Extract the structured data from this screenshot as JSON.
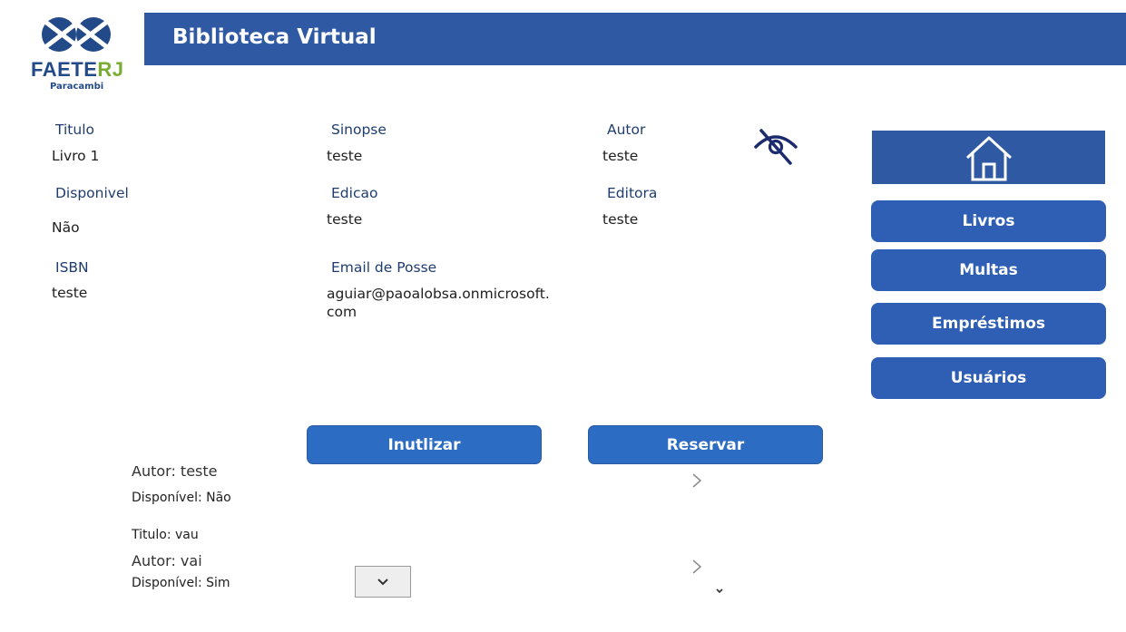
{
  "logo": {
    "main_a": "FAETE",
    "main_b": "RJ",
    "sub": "Paracambi"
  },
  "header": {
    "title": "Biblioteca Virtual"
  },
  "details": {
    "titulo_label": "Titulo",
    "titulo_value": "Livro 1",
    "sinopse_label": "Sinopse",
    "sinopse_value": "teste",
    "autor_label": "Autor",
    "autor_value": "teste",
    "disponivel_label": "Disponivel",
    "disponivel_value": "Não",
    "edicao_label": "Edicao",
    "edicao_value": "teste",
    "editora_label": "Editora",
    "editora_value": "teste",
    "isbn_label": "ISBN",
    "isbn_value": "teste",
    "email_label": "Email de Posse",
    "email_value": "aguiar@paoalobsa.onmicrosoft.com"
  },
  "icons": {
    "visibility": "eye-off-icon",
    "home": "home-icon"
  },
  "nav": {
    "livros": "Livros",
    "multas": "Multas",
    "emprestimos": "Empréstimos",
    "usuarios": "Usuários"
  },
  "actions": {
    "inutilizar": "Inutlizar",
    "reservar": "Reservar"
  },
  "gallery": {
    "items": [
      {
        "autor": "Autor: teste",
        "disponivel": "Disponível: Não"
      },
      {
        "titulo": "Titulo: vau",
        "autor": "Autor: vai",
        "disponivel": "Disponível: Sim"
      }
    ]
  },
  "colors": {
    "header": "#2f5aa3",
    "nav_button": "#2f5fb5",
    "action_button": "#2c6cc2",
    "logo_green": "#7aac32"
  }
}
